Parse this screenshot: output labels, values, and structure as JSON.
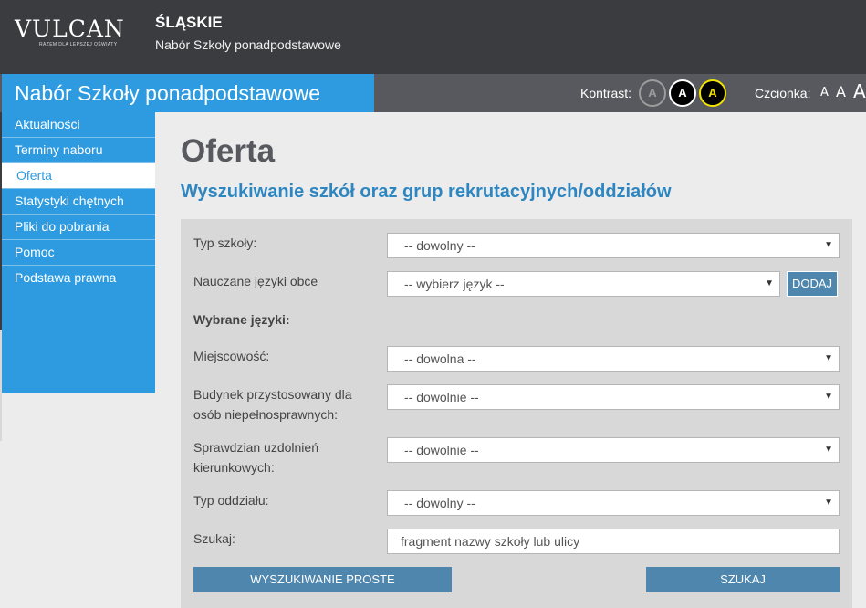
{
  "header": {
    "logo_text": "VULCAN",
    "logo_tagline": "RAZEM DLA LEPSZEJ OŚWIATY",
    "region_title": "ŚLĄSKIE",
    "region_subtitle": "Nabór Szkoły ponadpodstawowe"
  },
  "subbar": {
    "site_title": "Nabór Szkoły ponadpodstawowe",
    "contrast_label": "Kontrast:",
    "contrast_options": [
      "A",
      "A",
      "A"
    ],
    "font_label": "Czcionka:",
    "font_options": [
      "A",
      "A",
      "A"
    ]
  },
  "sidebar": {
    "items": [
      {
        "label": "Aktualności",
        "active": false
      },
      {
        "label": "Terminy naboru",
        "active": false
      },
      {
        "label": "Oferta",
        "active": true
      },
      {
        "label": "Statystyki chętnych",
        "active": false
      },
      {
        "label": "Pliki do pobrania",
        "active": false
      },
      {
        "label": "Pomoc",
        "active": false
      },
      {
        "label": "Podstawa prawna",
        "active": false
      }
    ]
  },
  "main": {
    "page_title": "Oferta",
    "page_subtitle": "Wyszukiwanie szkół oraz grup rekrutacyjnych/oddziałów"
  },
  "form": {
    "school_type": {
      "label": "Typ szkoły:",
      "value": "-- dowolny --"
    },
    "languages": {
      "label": "Nauczane języki obce",
      "value": "-- wybierz język --",
      "add_button": "DODAJ"
    },
    "selected_languages_label": "Wybrane języki:",
    "city": {
      "label": "Miejscowość:",
      "value": "-- dowolna --"
    },
    "accessible_building": {
      "label_line1": "Budynek przystosowany dla",
      "label_line2": "osób niepełnosprawnych:",
      "value": "-- dowolnie --"
    },
    "aptitude_test": {
      "label_line1": "Sprawdzian uzdolnień",
      "label_line2": "kierunkowych:",
      "value": "-- dowolnie --"
    },
    "class_type": {
      "label": "Typ oddziału:",
      "value": "-- dowolny --"
    },
    "search": {
      "label": "Szukaj:",
      "placeholder": "fragment nazwy szkoły lub ulicy"
    },
    "simple_search_button": "WYSZUKIWANIE PROSTE",
    "search_button": "SZUKAJ"
  },
  "colors": {
    "header_bg": "#3b3c40",
    "accent_blue": "#2e9be0",
    "subbar_bg": "#58595e",
    "button_blue": "#4f86ad",
    "panel_bg": "#d8d8d8"
  }
}
